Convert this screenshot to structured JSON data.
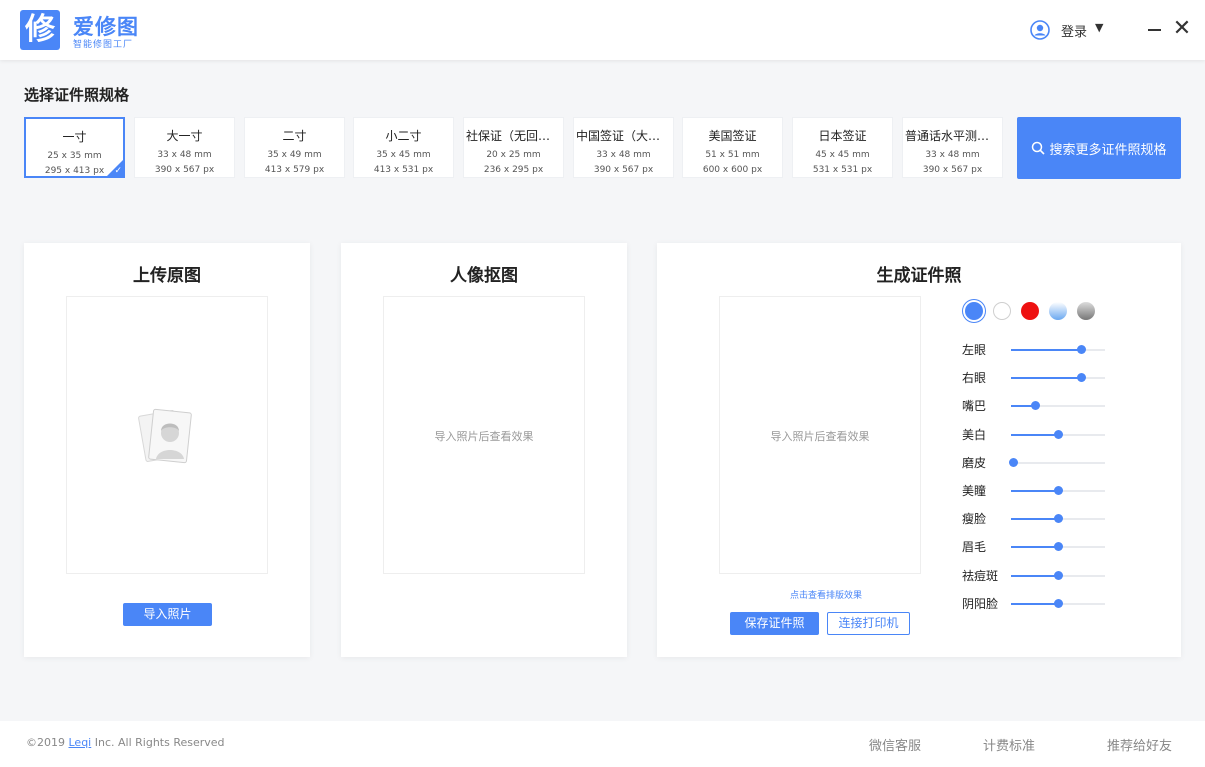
{
  "header": {
    "logo_char": "修",
    "app_name": "爱修图",
    "app_subtitle": "智能修图工厂",
    "login_label": "登录",
    "login_caret": "▼",
    "close_glyph": "✕"
  },
  "specs": {
    "title": "选择证件照规格",
    "items": [
      {
        "name": "一寸",
        "mm": "25 x 35 mm",
        "px": "295 x 413 px"
      },
      {
        "name": "大一寸",
        "mm": "33 x 48 mm",
        "px": "390 x 567 px"
      },
      {
        "name": "二寸",
        "mm": "35 x 49 mm",
        "px": "413 x 579 px"
      },
      {
        "name": "小二寸",
        "mm": "35 x 45 mm",
        "px": "413 x 531 px"
      },
      {
        "name": "社保证（无回执）",
        "mm": "20 x 25 mm",
        "px": "236 x 295 px"
      },
      {
        "name": "中国签证（大一寸）",
        "mm": "33 x 48 mm",
        "px": "390 x 567 px"
      },
      {
        "name": "美国签证",
        "mm": "51 x 51 mm",
        "px": "600 x 600 px"
      },
      {
        "name": "日本签证",
        "mm": "45 x 45 mm",
        "px": "531 x 531 px"
      },
      {
        "name": "普通话水平测试（...",
        "mm": "33 x 48 mm",
        "px": "390 x 567 px"
      }
    ],
    "selected_index": 0,
    "check_glyph": "✓",
    "search_label": "搜索更多证件照规格"
  },
  "upload": {
    "title": "上传原图",
    "import_label": "导入照片"
  },
  "cutout": {
    "title": "人像抠图",
    "placeholder": "导入照片后查看效果"
  },
  "generate": {
    "title": "生成证件照",
    "placeholder": "导入照片后查看效果",
    "layout_link": "点击查看排版效果",
    "save_label": "保存证件照",
    "print_label": "连接打印机",
    "backgrounds": [
      {
        "color": "#4a86f7",
        "style": "solid-blue",
        "selected": true
      },
      {
        "color": "#ffffff",
        "style": "white",
        "selected": false
      },
      {
        "color": "#ee1111",
        "style": "red",
        "selected": false
      },
      {
        "color": "#6aa8f0",
        "style": "gradient-blue",
        "selected": false
      },
      {
        "color": "#777777",
        "style": "gradient-gray",
        "selected": false
      }
    ],
    "sliders": [
      {
        "label": "左眼",
        "value": 0.74
      },
      {
        "label": "右眼",
        "value": 0.74
      },
      {
        "label": "嘴巴",
        "value": 0.26
      },
      {
        "label": "美白",
        "value": 0.5
      },
      {
        "label": "磨皮",
        "value": 0.02
      },
      {
        "label": "美瞳",
        "value": 0.5
      },
      {
        "label": "瘦脸",
        "value": 0.5
      },
      {
        "label": "眉毛",
        "value": 0.5
      },
      {
        "label": "祛痘斑",
        "value": 0.5
      },
      {
        "label": "阴阳脸",
        "value": 0.5
      }
    ]
  },
  "footer": {
    "copyright_prefix": "©2019",
    "copyright_link": "Leqi",
    "copyright_suffix": "Inc. All Rights Reserved",
    "links": [
      "微信客服",
      "计费标准",
      "推荐给好友"
    ]
  }
}
